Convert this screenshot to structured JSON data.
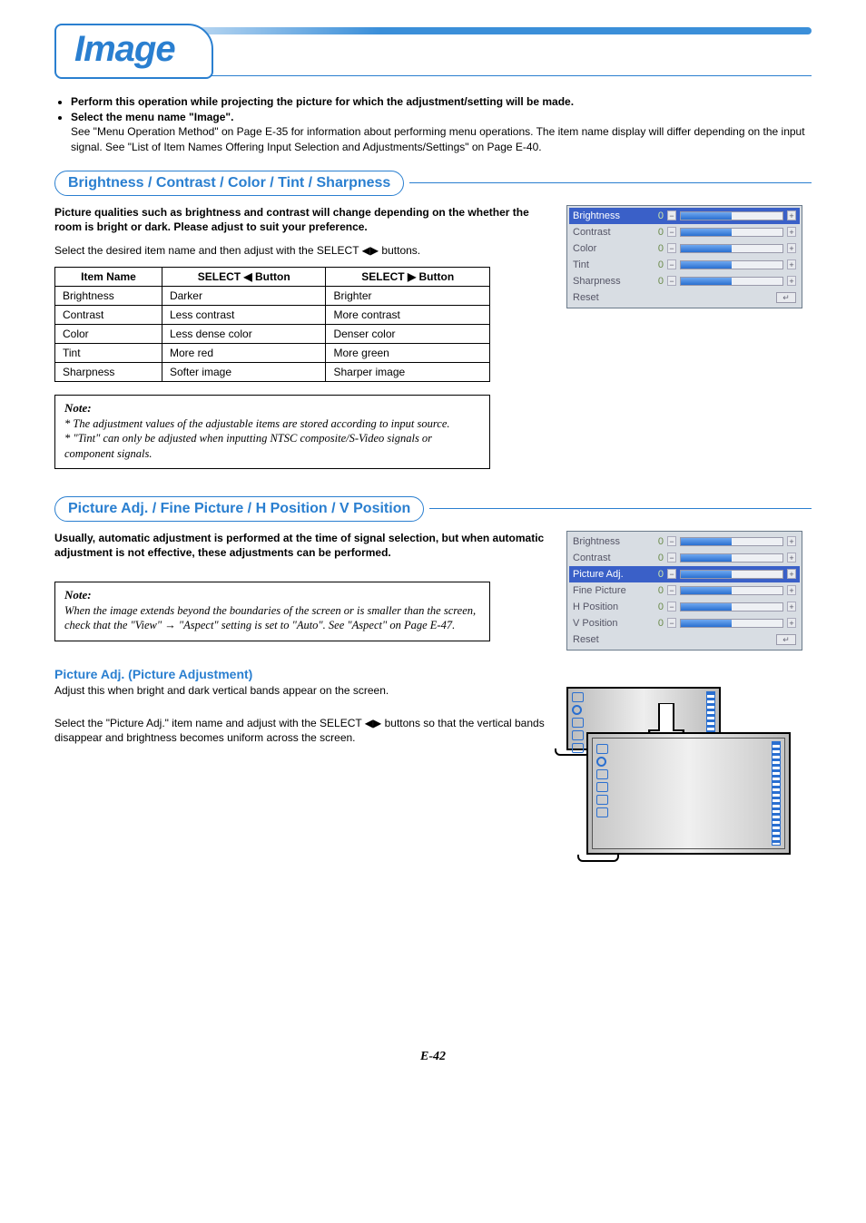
{
  "page_title": "Image",
  "intro": {
    "bullet1": "Perform this operation while projecting the picture for which the adjustment/setting will be made.",
    "bullet2": "Select the menu name \"Image\".",
    "subtext": "See \"Menu Operation Method\" on Page E-35 for information about performing menu operations. The item name display will differ depending on the input signal. See \"List of Item Names Offering Input Selection and Adjustments/Settings\" on Page E-40."
  },
  "section1": {
    "header": "Brightness / Contrast / Color / Tint / Sharpness",
    "blurb_bold": "Picture qualities such as brightness and contrast will change depending on the whether the room is bright or dark. Please adjust to suit your preference.",
    "blurb_plain": "Select the desired item name and then adjust with the SELECT ◀▶ buttons.",
    "table": {
      "h1": "Item Name",
      "h2": "SELECT ◀ Button",
      "h3": "SELECT ▶ Button",
      "rows": [
        {
          "c1": "Brightness",
          "c2": "Darker",
          "c3": "Brighter"
        },
        {
          "c1": "Contrast",
          "c2": "Less contrast",
          "c3": "More contrast"
        },
        {
          "c1": "Color",
          "c2": "Less dense color",
          "c3": "Denser color"
        },
        {
          "c1": "Tint",
          "c2": "More red",
          "c3": "More green"
        },
        {
          "c1": "Sharpness",
          "c2": "Softer image",
          "c3": "Sharper image"
        }
      ]
    },
    "note_head": "Note:",
    "note1": "* The adjustment values of the adjustable items are stored according to input source.",
    "note2": "* \"Tint\" can only be adjusted when inputting NTSC composite/S-Video signals or component signals.",
    "osd": [
      {
        "label": "Brightness",
        "val": "0",
        "sel": true
      },
      {
        "label": "Contrast",
        "val": "0"
      },
      {
        "label": "Color",
        "val": "0"
      },
      {
        "label": "Tint",
        "val": "0"
      },
      {
        "label": "Sharpness",
        "val": "0"
      }
    ],
    "osd_reset": "Reset"
  },
  "section2": {
    "header": "Picture Adj. / Fine Picture / H Position / V Position",
    "blurb_bold": "Usually, automatic adjustment is performed at the time of signal selection, but when automatic adjustment is not effective, these adjustments can be performed.",
    "note_head": "Note:",
    "note1": "When the image extends beyond the boundaries of the screen or is smaller than the screen, check that the \"View\" → \"Aspect\" setting is set to \"Auto\". See \"Aspect\" on Page E-47.",
    "osd": [
      {
        "label": "Brightness",
        "val": "0"
      },
      {
        "label": "Contrast",
        "val": "0"
      },
      {
        "label": "Picture Adj.",
        "val": "0",
        "sel": true
      },
      {
        "label": "Fine Picture",
        "val": "0"
      },
      {
        "label": "H Position",
        "val": "0"
      },
      {
        "label": "V Position",
        "val": "0"
      }
    ],
    "osd_reset": "Reset"
  },
  "section3": {
    "header": "Picture Adj. (Picture Adjustment)",
    "line1": "Adjust this when bright and dark vertical bands appear on the screen.",
    "line2": "Select the \"Picture Adj.\" item name and adjust with the SELECT ◀▶ buttons so that the vertical bands disappear and brightness becomes uniform across the screen."
  },
  "pagenum": "E-42",
  "glyphs": {
    "minus": "−",
    "plus": "+",
    "enter": "↵"
  }
}
